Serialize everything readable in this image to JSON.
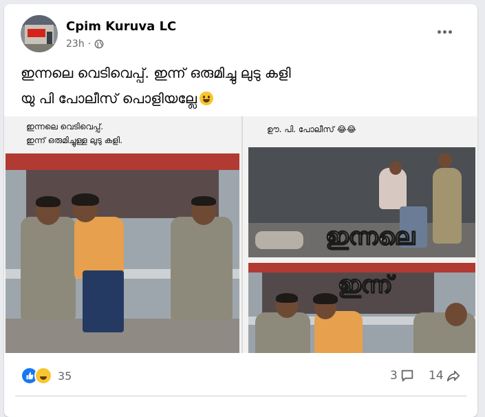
{
  "post": {
    "page_name": "Cpim Kuruva LC",
    "timestamp": "23h",
    "separator": "·",
    "audience_icon": "globe-icon",
    "caption_line1": "ഇന്നലെ വെടിവെപ്പ്. ഇന്ന് ഒരുമിച്ചു ലുടു കളി",
    "caption_line2": "യു പി പോലീസ് പൊളിയല്ലേ"
  },
  "media": {
    "left_text_line1": "ഇന്നലെ വെടിവെപ്പ്.",
    "left_text_line2": "ഇന്ന് ഒരുമിച്ചുള്ള ലുടു കളി.",
    "right_text": "ഊ. പി. പോലീസ് 😂😂",
    "overlay_top": "ഇന്നലെ",
    "overlay_bottom": "ഇന്ന്"
  },
  "footer": {
    "reaction_count": "35",
    "comment_count": "3",
    "share_count": "14",
    "reaction_icons": [
      "like-icon",
      "haha-icon"
    ]
  },
  "colors": {
    "brand_blue": "#1877f2",
    "text_primary": "#050505",
    "text_secondary": "#65676b"
  }
}
